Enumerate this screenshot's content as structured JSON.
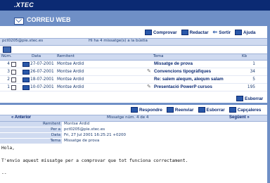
{
  "brand": ".XTEC",
  "app_title": "CORREU WEB",
  "toolbar_top": {
    "compose": "Comprovar",
    "send": "Redactar",
    "exit": "Sortir",
    "help": "Ajuda"
  },
  "account": "pct0205@pie.xtec.es",
  "new_mail_notice": "Hi ha  4 missatge(s) a la bústia",
  "table": {
    "headers": {
      "num": "Núm.",
      "date": "Data",
      "sender": "Remitent",
      "subject": "Tema",
      "size": "Kb"
    },
    "rows": [
      {
        "num": "4",
        "date": "27-07-2001",
        "sender": "Montse Ardid",
        "subject": "Missatge de prova",
        "kb": "1",
        "attach": false
      },
      {
        "num": "3",
        "date": "26-07-2001",
        "sender": "Montse Ardid",
        "subject": "Convencions tipogràfiques",
        "kb": "34",
        "attach": true
      },
      {
        "num": "2",
        "date": "18-07-2001",
        "sender": "Montse Ardid",
        "subject": "Re: salem alequm, alequm salam",
        "kb": "5",
        "attach": false
      },
      {
        "num": "1",
        "date": "10-07-2001",
        "sender": "Montse Ardid",
        "subject": "Presentació PowerP cursos",
        "kb": "195",
        "attach": true
      }
    ]
  },
  "delete_label": "Esborrar",
  "toolbar_msg": {
    "reply": "Respondre",
    "forward": "Reenviar",
    "delete": "Esborrar",
    "headers": "Capçaleres"
  },
  "nav": {
    "prev": "Anterior",
    "position": "Missatge núm. 4  de 4",
    "next": "Següent"
  },
  "message_headers": [
    {
      "label": "Remitent",
      "value": "Montse Ardid"
    },
    {
      "label": "Per a",
      "value": "pct0205@pie.xtec.es"
    },
    {
      "label": "Data",
      "value": "Fri, 27 Jul 2001 16:25:21 +0200"
    },
    {
      "label": "Tema",
      "value": "Missatge de prova"
    }
  ],
  "message_body": {
    "line1": "Hola,",
    "line2": "",
    "line3": "T'envio aquest missatge per a comprovar que tot funciona correctament.",
    "line4": "",
    "line5": "--"
  }
}
